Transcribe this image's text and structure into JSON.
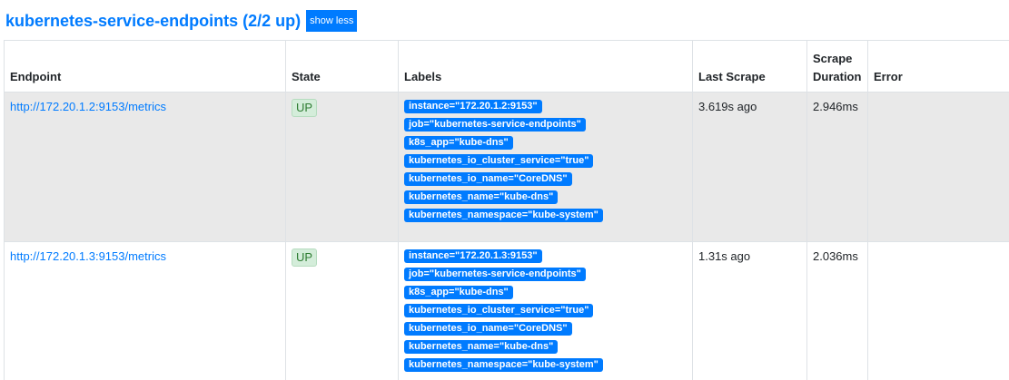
{
  "job": {
    "title": "kubernetes-service-endpoints (2/2 up)",
    "toggle_label": "show less"
  },
  "table": {
    "headers": {
      "endpoint": "Endpoint",
      "state": "State",
      "labels": "Labels",
      "last_scrape": "Last Scrape",
      "scrape_duration_line1": "Scrape",
      "scrape_duration_line2": "Duration",
      "error": "Error"
    },
    "rows": [
      {
        "endpoint": "http://172.20.1.2:9153/metrics",
        "state": "UP",
        "labels": [
          "instance=\"172.20.1.2:9153\"",
          "job=\"kubernetes-service-endpoints\"",
          "k8s_app=\"kube-dns\"",
          "kubernetes_io_cluster_service=\"true\"",
          "kubernetes_io_name=\"CoreDNS\"",
          "kubernetes_name=\"kube-dns\"",
          "kubernetes_namespace=\"kube-system\""
        ],
        "last_scrape": "3.619s ago",
        "scrape_duration": "2.946ms",
        "error": ""
      },
      {
        "endpoint": "http://172.20.1.3:9153/metrics",
        "state": "UP",
        "labels": [
          "instance=\"172.20.1.3:9153\"",
          "job=\"kubernetes-service-endpoints\"",
          "k8s_app=\"kube-dns\"",
          "kubernetes_io_cluster_service=\"true\"",
          "kubernetes_io_name=\"CoreDNS\"",
          "kubernetes_name=\"kube-dns\"",
          "kubernetes_namespace=\"kube-system\""
        ],
        "last_scrape": "1.31s ago",
        "scrape_duration": "2.036ms",
        "error": ""
      }
    ]
  },
  "colors": {
    "accent": "#007bff",
    "row_shaded": "#e9e9e9",
    "state_up_bg": "#d4edda",
    "state_up_text": "#2e7d32"
  }
}
